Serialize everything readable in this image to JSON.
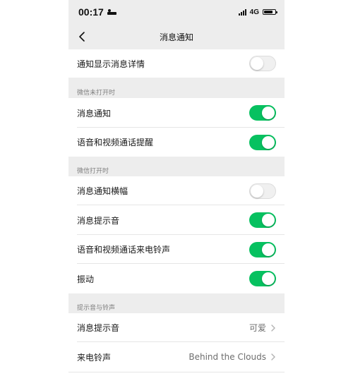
{
  "status_bar": {
    "time": "00:17",
    "network": "4G"
  },
  "nav": {
    "title": "消息通知"
  },
  "rows": {
    "detail": {
      "label": "通知显示消息详情",
      "on": false
    },
    "wechat_closed_header": "微信未打开时",
    "msg_notify": {
      "label": "消息通知",
      "on": true
    },
    "call_remind": {
      "label": "语音和视频通话提醒",
      "on": true
    },
    "wechat_open_header": "微信打开时",
    "banner": {
      "label": "消息通知横幅",
      "on": false
    },
    "msg_sound": {
      "label": "消息提示音",
      "on": true
    },
    "call_ringtone": {
      "label": "语音和视频通话来电铃声",
      "on": true
    },
    "vibrate": {
      "label": "振动",
      "on": true
    },
    "sounds_header": "提示音与铃声",
    "alert_sound": {
      "label": "消息提示音",
      "value": "可爱"
    },
    "ringtone": {
      "label": "来电铃声",
      "value": "Behind the Clouds"
    }
  },
  "colors": {
    "accent": "#07c160",
    "background": "#ededed"
  }
}
